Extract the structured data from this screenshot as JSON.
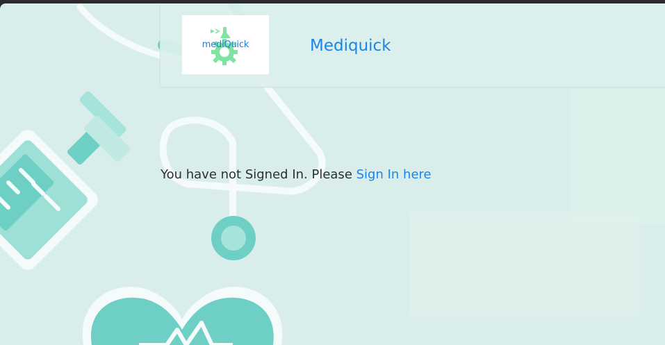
{
  "header": {
    "logo_text": "mediQuick",
    "brand": "Mediquick"
  },
  "message": {
    "text": "You have not Signed In. Please",
    "link": "Sign In here"
  },
  "colors": {
    "background": "#d9eeea",
    "accent": "#1a85e8",
    "logo_green": "#7fe3a2",
    "art_teal": "#6ed0c4"
  },
  "icons": {
    "logo": "mediquick-logo-icon"
  }
}
